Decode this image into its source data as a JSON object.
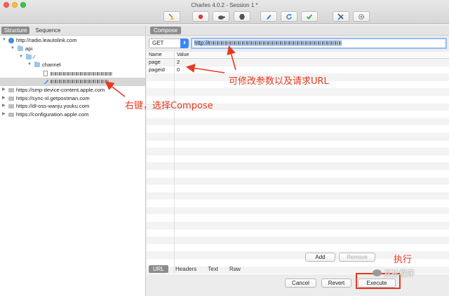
{
  "window": {
    "title": "Charles 4.0.2 - Session 1 *"
  },
  "toolbar": {
    "buttons": [
      {
        "name": "broom",
        "icon": "broom-icon"
      },
      {
        "name": "record",
        "icon": "record-icon"
      },
      {
        "name": "throttle",
        "icon": "turtle-icon"
      },
      {
        "name": "breakpoints",
        "icon": "hexagon-icon"
      },
      {
        "name": "compose",
        "icon": "pen-icon"
      },
      {
        "name": "repeat",
        "icon": "refresh-icon"
      },
      {
        "name": "validate",
        "icon": "check-icon"
      },
      {
        "name": "tools",
        "icon": "tools-icon"
      },
      {
        "name": "settings",
        "icon": "gear-icon"
      }
    ]
  },
  "left": {
    "tabs": [
      "Structure",
      "Sequence"
    ],
    "active_tab": "Structure",
    "tree": [
      {
        "label": "http://radio.leautolink.com",
        "level": 0,
        "expanded": true,
        "icon": "globe-icon"
      },
      {
        "label": "api",
        "level": 1,
        "expanded": true,
        "icon": "folder-icon"
      },
      {
        "label": "∕",
        "level": 2,
        "expanded": true,
        "icon": "folder-icon"
      },
      {
        "label": "channel",
        "level": 3,
        "expanded": true,
        "icon": "folder-icon"
      },
      {
        "label": "",
        "level": 4,
        "icon": "document-icon"
      },
      {
        "label": "",
        "level": 4,
        "icon": "compose-icon",
        "selected": true
      },
      {
        "label": "https://smp-device-content.apple.com",
        "level": 0,
        "icon": "lock-icon"
      },
      {
        "label": "https://sync-xl.getpostman.com",
        "level": 0,
        "icon": "lock-icon"
      },
      {
        "label": "https://dl-oss-wanju.youku.com",
        "level": 0,
        "icon": "lock-icon"
      },
      {
        "label": "https://configuration.apple.com",
        "level": 0,
        "icon": "lock-icon"
      }
    ]
  },
  "compose": {
    "tab_label": "Compose",
    "method": "GET",
    "url_prefix": "http://",
    "params": {
      "headers": [
        "Name",
        "Value"
      ],
      "rows": [
        {
          "name": "page",
          "value": "2"
        },
        {
          "name": "pageid",
          "value": "0"
        }
      ]
    },
    "add_label": "Add",
    "remove_label": "Remove",
    "subtabs": [
      "URL",
      "Headers",
      "Text",
      "Raw"
    ],
    "active_subtab": "URL",
    "cancel_label": "Cancel",
    "revert_label": "Revert",
    "execute_label": "Execute"
  },
  "annotations": {
    "modify": "可修改参数以及请求URL",
    "right_click": "右键，选择Compose",
    "execute": "执行",
    "color": "#e6391f"
  },
  "watermark": {
    "text": "互扯程序"
  }
}
